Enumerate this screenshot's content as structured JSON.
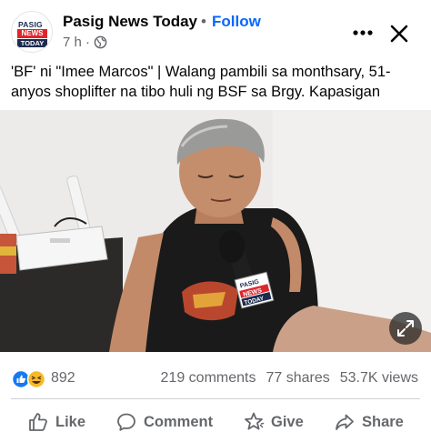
{
  "header": {
    "logo_lines": [
      "PASIG",
      "NEWS",
      "TODAY"
    ],
    "page_name": "Pasig News Today",
    "separator": "•",
    "follow_label": "Follow",
    "time": "7 h ·"
  },
  "post": {
    "caption": "'BF' ni \"Imee Marcos\" | Walang pambili sa monthsary, 51-anyos shoplifter na tibo huli ng BSF sa Brgy. Kapasigan",
    "mic_flag_lines": [
      "PASIG",
      "NEWS",
      "TODAY"
    ]
  },
  "stats": {
    "reactions_count": "892",
    "comments": "219 comments",
    "shares": "77 shares",
    "views": "53.7K views"
  },
  "actions": {
    "like": "Like",
    "comment": "Comment",
    "give": "Give",
    "share": "Share"
  },
  "colors": {
    "follow_blue": "#0866ff",
    "meta_gray": "#65676b",
    "like_blue": "#1877f2",
    "haha_yellow": "#f7b928"
  },
  "icons": [
    "globe-icon",
    "more-icon",
    "close-icon",
    "expand-icon",
    "like-reaction-icon",
    "haha-reaction-icon",
    "like-icon",
    "comment-icon",
    "give-icon",
    "share-icon"
  ]
}
